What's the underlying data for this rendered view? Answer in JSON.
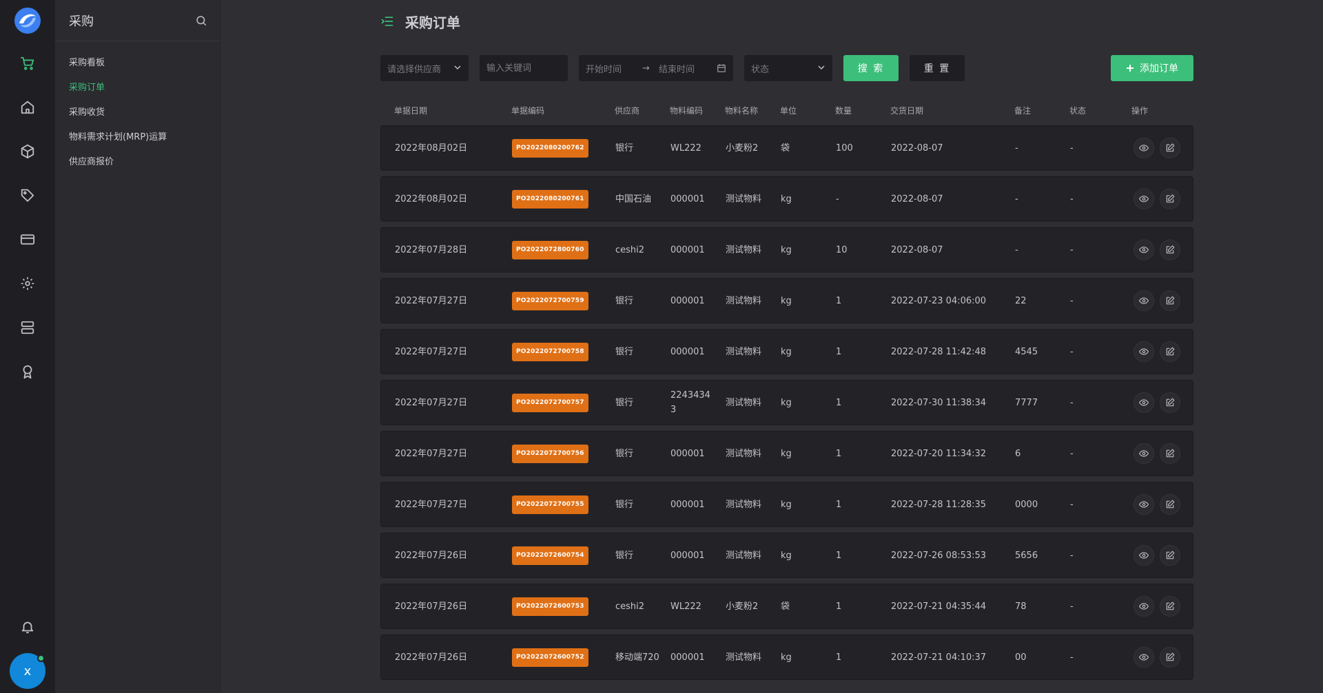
{
  "app": {
    "module_title": "采购",
    "page_title": "采购订单",
    "user_initial": "x"
  },
  "theme": {
    "accent": "#3cbf7a",
    "badge": "#e07016",
    "avatar": "#1188d9"
  },
  "rail": [
    {
      "icon": "cart-icon",
      "active": true
    },
    {
      "icon": "home-icon",
      "active": false
    },
    {
      "icon": "box-icon",
      "active": false
    },
    {
      "icon": "tag-icon",
      "active": false
    },
    {
      "icon": "card-icon",
      "active": false
    },
    {
      "icon": "gear-icon",
      "active": false
    },
    {
      "icon": "server-icon",
      "active": false
    },
    {
      "icon": "award-icon",
      "active": false
    }
  ],
  "subnav": {
    "items": [
      {
        "label": "采购看板",
        "active": false
      },
      {
        "label": "采购订单",
        "active": true
      },
      {
        "label": "采购收货",
        "active": false
      },
      {
        "label": "物料需求计划(MRP)运算",
        "active": false
      },
      {
        "label": "供应商报价",
        "active": false
      }
    ]
  },
  "filters": {
    "supplier_placeholder": "请选择供应商",
    "keyword_placeholder": "输入关键词",
    "start_placeholder": "开始时间",
    "range_sep": "→",
    "end_placeholder": "结束时间",
    "status_placeholder": "状态",
    "search_label": "搜 索",
    "reset_label": "重 置",
    "add_label": "添加订单"
  },
  "table": {
    "columns": [
      "单据日期",
      "单据编码",
      "供应商",
      "物料编码",
      "物料名称",
      "单位",
      "数量",
      "交货日期",
      "备注",
      "状态",
      "操作"
    ],
    "rows": [
      [
        "2022年08月02日",
        "PO2022080200762",
        "银行",
        "WL222",
        "小麦粉2",
        "袋",
        "100",
        "2022-08-07",
        "-",
        "-"
      ],
      [
        "2022年08月02日",
        "PO2022080200761",
        "中国石油",
        "000001",
        "测试物料",
        "kg",
        "-",
        "2022-08-07",
        "-",
        "-"
      ],
      [
        "2022年07月28日",
        "PO2022072800760",
        "ceshi2",
        "000001",
        "测试物料",
        "kg",
        "10",
        "2022-08-07",
        "-",
        "-"
      ],
      [
        "2022年07月27日",
        "PO2022072700759",
        "银行",
        "000001",
        "测试物料",
        "kg",
        "1",
        "2022-07-23 04:06:00",
        "22",
        "-"
      ],
      [
        "2022年07月27日",
        "PO2022072700758",
        "银行",
        "000001",
        "测试物料",
        "kg",
        "1",
        "2022-07-28 11:42:48",
        "4545",
        "-"
      ],
      [
        "2022年07月27日",
        "PO2022072700757",
        "银行",
        "22434343",
        "测试物料",
        "kg",
        "1",
        "2022-07-30 11:38:34",
        "7777",
        "-"
      ],
      [
        "2022年07月27日",
        "PO2022072700756",
        "银行",
        "000001",
        "测试物料",
        "kg",
        "1",
        "2022-07-20 11:34:32",
        "6",
        "-"
      ],
      [
        "2022年07月27日",
        "PO2022072700755",
        "银行",
        "000001",
        "测试物料",
        "kg",
        "1",
        "2022-07-28 11:28:35",
        "0000",
        "-"
      ],
      [
        "2022年07月26日",
        "PO2022072600754",
        "银行",
        "000001",
        "测试物料",
        "kg",
        "1",
        "2022-07-26 08:53:53",
        "5656",
        "-"
      ],
      [
        "2022年07月26日",
        "PO2022072600753",
        "ceshi2",
        "WL222",
        "小麦粉2",
        "袋",
        "1",
        "2022-07-21 04:35:44",
        "78",
        "-"
      ],
      [
        "2022年07月26日",
        "PO2022072600752",
        "移动端720",
        "000001",
        "测试物料",
        "kg",
        "1",
        "2022-07-21 04:10:37",
        "00",
        "-"
      ]
    ]
  }
}
